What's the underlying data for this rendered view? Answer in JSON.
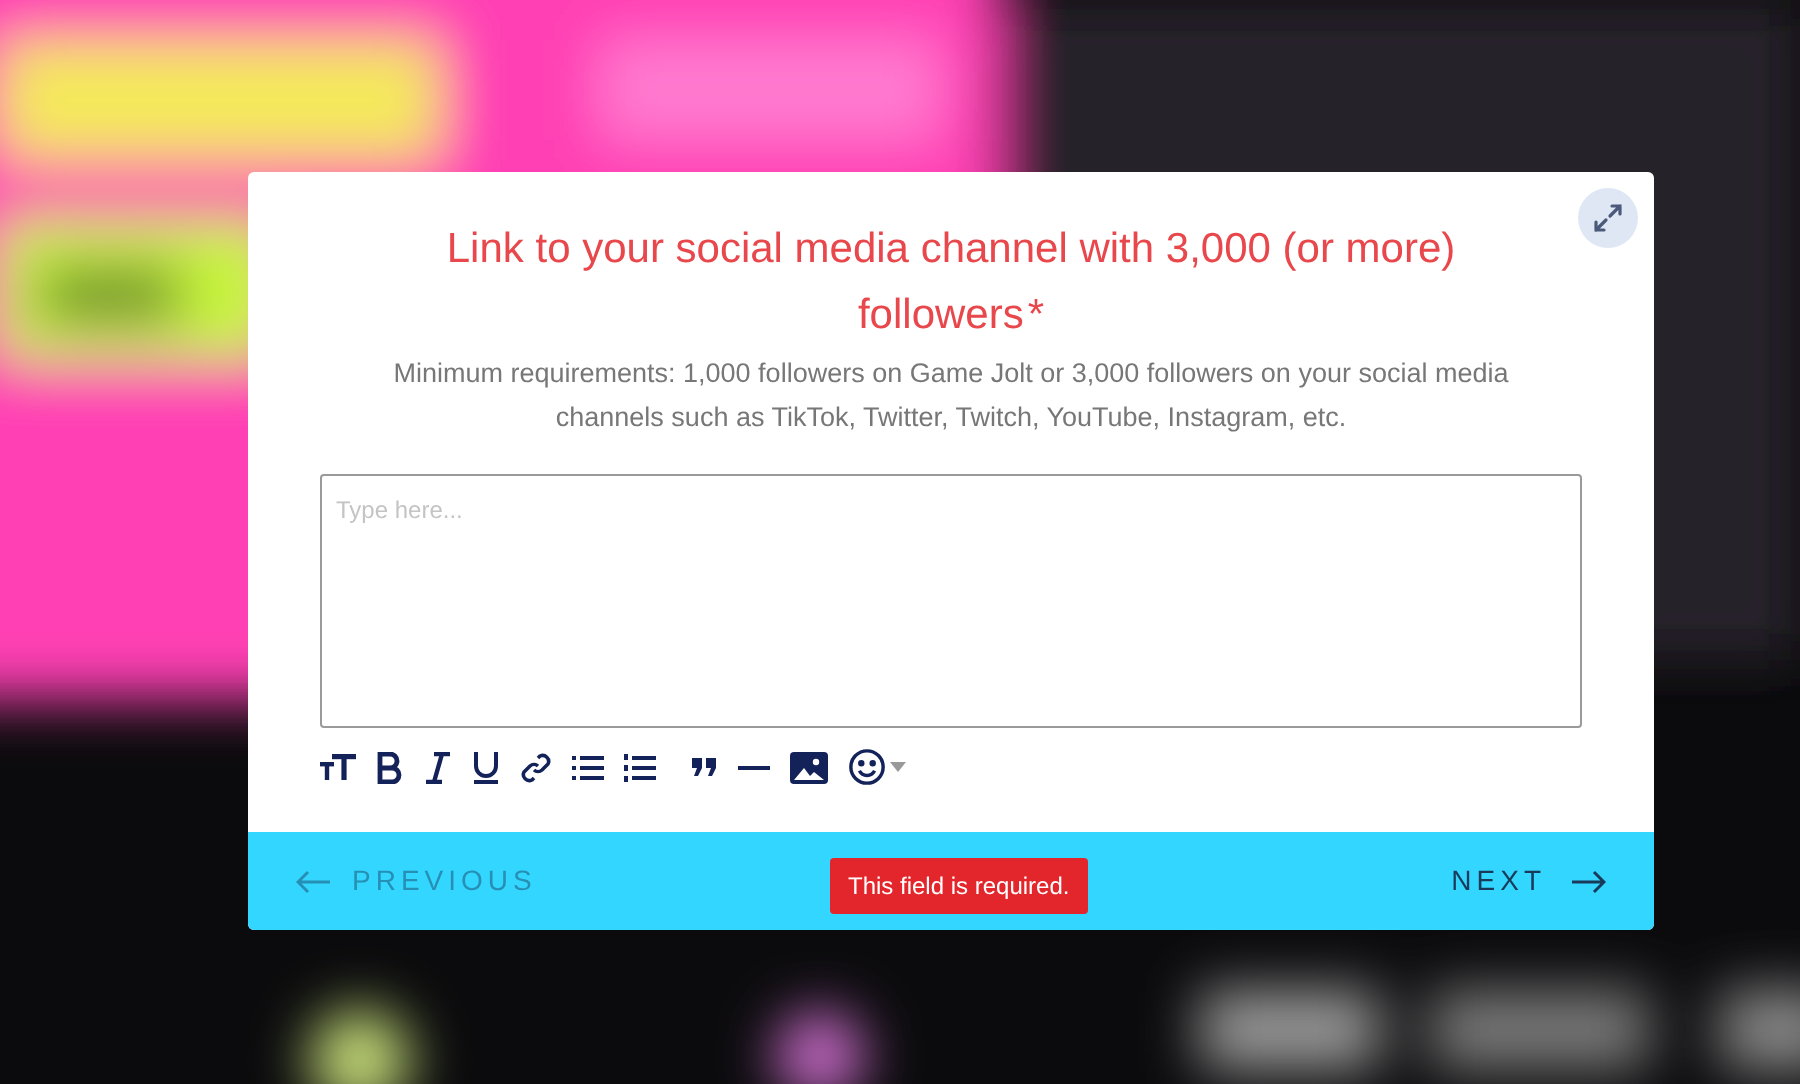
{
  "dialog": {
    "title": "Link to your social media channel with 3,000 (or more) followers",
    "required_mark": "*",
    "description": "Minimum requirements: 1,000 followers on Game Jolt or 3,000 followers on your social media channels such as TikTok, Twitter, Twitch, YouTube, Instagram, etc.",
    "editor": {
      "placeholder": "Type here..."
    },
    "footer": {
      "previous": {
        "label": "PREVIOUS",
        "disabled": true
      },
      "error": "This field is required.",
      "next": {
        "label": "NEXT",
        "disabled": false
      }
    }
  }
}
